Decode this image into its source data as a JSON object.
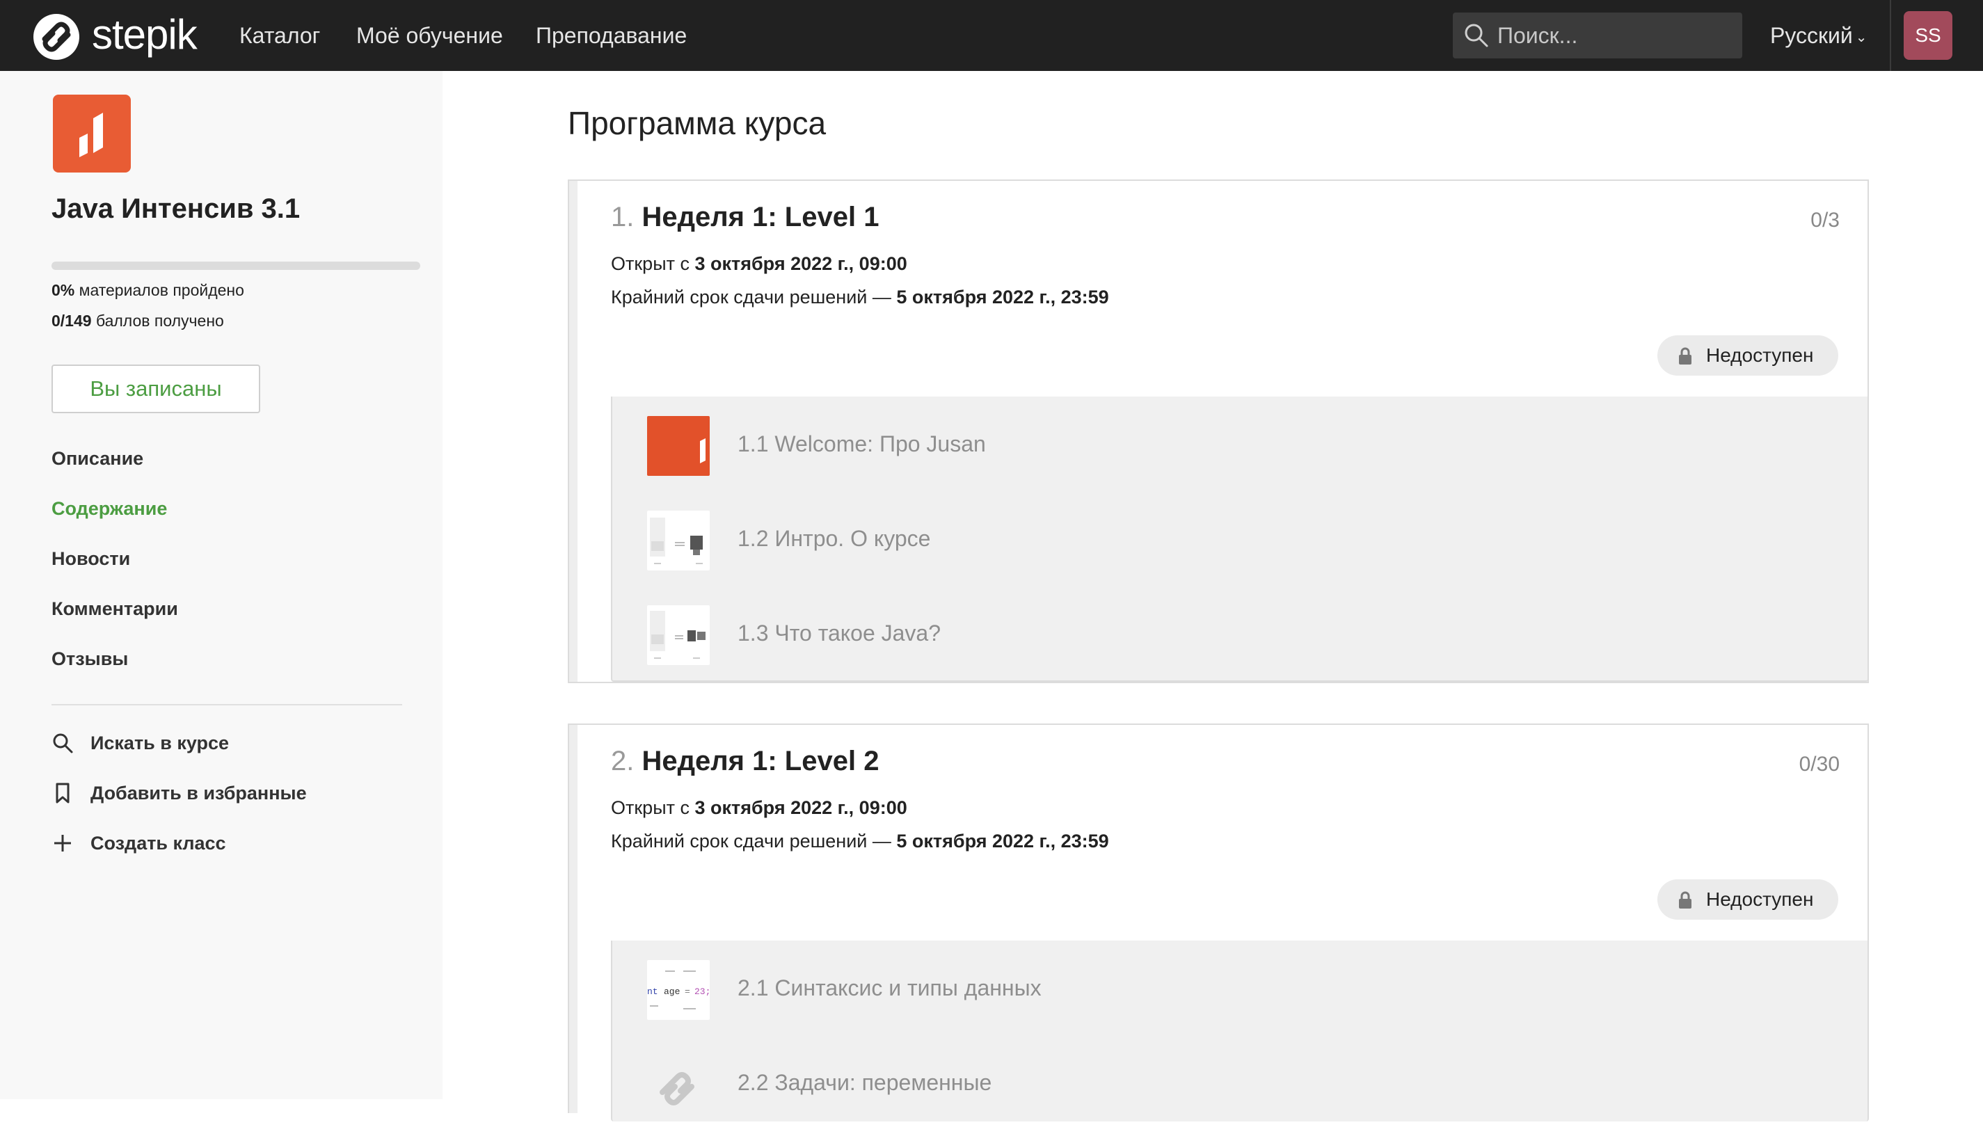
{
  "topbar": {
    "brand": "stepik",
    "nav": [
      "Каталог",
      "Моё обучение",
      "Преподавание"
    ],
    "search_placeholder": "Поиск...",
    "language": "Русский",
    "avatar_initials": "SS",
    "avatar_color": "#a24a5b"
  },
  "sidebar": {
    "course_title": "Java Интенсив 3.1",
    "progress_fraction": 0,
    "materials_pct": "0%",
    "materials_text": "материалов пройдено",
    "points_value": "0/149",
    "points_text": "баллов получено",
    "enrolled_label": "Вы записаны",
    "links": [
      "Описание",
      "Содержание",
      "Новости",
      "Комментарии",
      "Отзывы"
    ],
    "active_link": "Содержание",
    "actions": [
      {
        "label": "Искать в курсе",
        "icon": "search-icon"
      },
      {
        "label": "Добавить в избранные",
        "icon": "bookmark-icon"
      },
      {
        "label": "Создать класс",
        "icon": "plus-icon"
      }
    ]
  },
  "main": {
    "page_title": "Программа курса",
    "sections": [
      {
        "number": "1.",
        "title": "Неделя 1: Level 1",
        "score": "0/3",
        "open_prefix": "Открыт с",
        "open_date": "3 октября 2022 г., 09:00",
        "deadline_prefix": "Крайний срок сдачи решений —",
        "deadline_date": "5 октября 2022 г., 23:59",
        "status": "Недоступен",
        "lessons": [
          {
            "title": "1.1 Welcome: Про Jusan",
            "thumb": "orange-logo"
          },
          {
            "title": "1.2 Интро. О курсе",
            "thumb": "slide"
          },
          {
            "title": "1.3 Что такое Java?",
            "thumb": "slide"
          }
        ]
      },
      {
        "number": "2.",
        "title": "Неделя 1: Level 2",
        "score": "0/30",
        "open_prefix": "Открыт с",
        "open_date": "3 октября 2022 г., 09:00",
        "deadline_prefix": "Крайний срок сдачи решений —",
        "deadline_date": "5 октября 2022 г., 23:59",
        "status": "Недоступен",
        "lessons": [
          {
            "title": "2.1 Синтаксис и типы данных",
            "thumb": "code-slide",
            "code_words": [
              "nt",
              "age",
              "=",
              "23;"
            ]
          },
          {
            "title": "2.2 Задачи: переменные",
            "thumb": "stepik-logo"
          }
        ]
      }
    ]
  },
  "colors": {
    "topbar_bg": "#212121",
    "accent_green": "#4c9d42",
    "course_orange": "#e85c34"
  }
}
